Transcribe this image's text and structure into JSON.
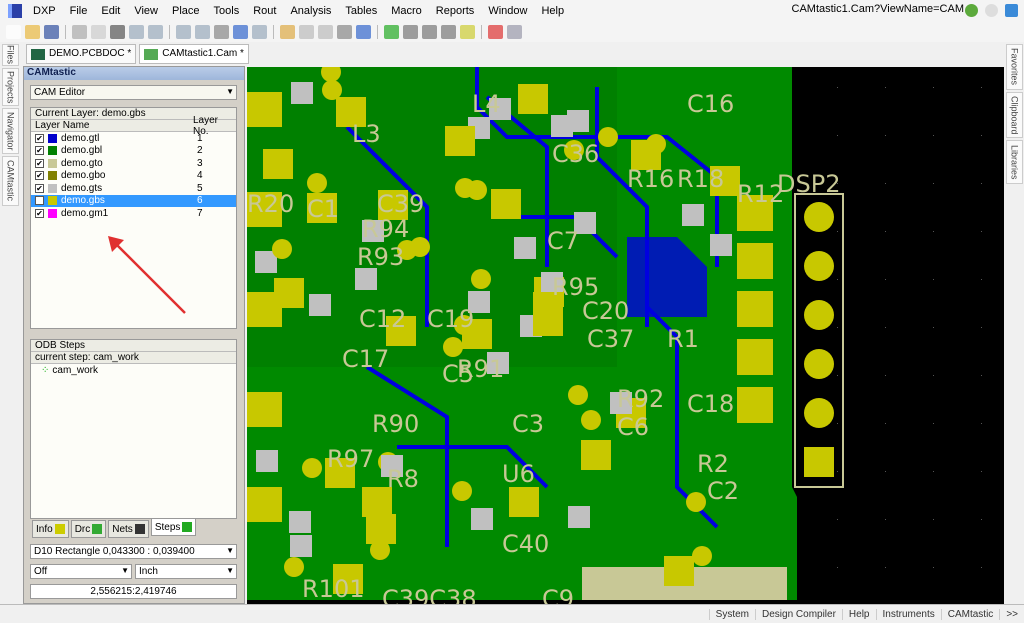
{
  "app": {
    "name": "DXP",
    "view_name": "CAMtastic1.Cam?ViewName=CAM"
  },
  "menu": [
    "File",
    "Edit",
    "View",
    "Place",
    "Tools",
    "Rout",
    "Analysis",
    "Tables",
    "Macro",
    "Reports",
    "Window",
    "Help"
  ],
  "doc_tabs": [
    {
      "label": "DEMO.PCBDOC *"
    },
    {
      "label": "CAMtastic1.Cam *",
      "active": true
    }
  ],
  "left_side_tabs": [
    "Files",
    "Projects",
    "Navigator",
    "CAMtastic"
  ],
  "right_side_tabs": [
    "Favorites",
    "Clipboard",
    "Libraries"
  ],
  "panel": {
    "title": "CAMtastic",
    "editor_select": "CAM Editor",
    "current_layer": "Current Layer: demo.gbs",
    "columns": [
      "Layer Name",
      "Layer No."
    ],
    "layers": [
      {
        "name": "demo.gtl",
        "no": "1",
        "color": "#0000cc",
        "checked": true
      },
      {
        "name": "demo.gbl",
        "no": "2",
        "color": "#008000",
        "checked": true
      },
      {
        "name": "demo.gto",
        "no": "3",
        "color": "#c8c896",
        "checked": true
      },
      {
        "name": "demo.gbo",
        "no": "4",
        "color": "#808000",
        "checked": true
      },
      {
        "name": "demo.gts",
        "no": "5",
        "color": "#c0c0c0",
        "checked": true
      },
      {
        "name": "demo.gbs",
        "no": "6",
        "color": "#c8c800",
        "checked": true,
        "selected": true
      },
      {
        "name": "demo.gm1",
        "no": "7",
        "color": "#ff00ff",
        "checked": true
      }
    ],
    "odb": {
      "title": "ODB Steps",
      "current": "current step: cam_work",
      "steps": [
        "cam_work"
      ]
    },
    "bottom_tabs": [
      "Info",
      "Drc",
      "Nets",
      "Steps"
    ],
    "active_bottom_tab": "Steps",
    "aperture": "D10   Rectangle   0,043300 : 0,039400",
    "snap": "Off",
    "units": "Inch",
    "coords": "2,556215:2,419746"
  },
  "pcb_labels": [
    "L4",
    "L3",
    "C16",
    "C36",
    "R18",
    "R16",
    "R12",
    "DSP2",
    "R20",
    "C1",
    "C39",
    "R94",
    "R93",
    "C7",
    "C12",
    "C19",
    "R95",
    "C20",
    "C37",
    "R1",
    "C17",
    "C5",
    "R91",
    "R92",
    "C18",
    "R2",
    "C6",
    "R90",
    "C3",
    "R97",
    "U6",
    "R8",
    "C2",
    "C40",
    "R101",
    "C39C38",
    "C9"
  ],
  "statusbar": [
    "System",
    "Design Compiler",
    "Help",
    "Instruments",
    "CAMtastic",
    ">>"
  ],
  "colors": {
    "board": "#008a00",
    "pad": "#c8c800",
    "pad_gray": "#c0c0c0",
    "trace_blue": "#0000e0",
    "silk": "#c8c896",
    "selection": "#3399ff"
  }
}
